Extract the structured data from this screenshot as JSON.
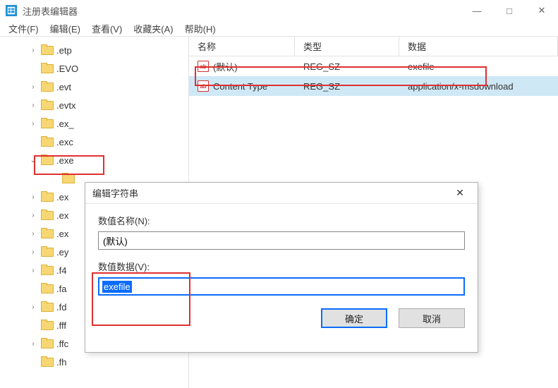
{
  "window": {
    "title": "注册表编辑器"
  },
  "menu": {
    "file": "文件(F)",
    "edit": "编辑(E)",
    "view": "查看(V)",
    "fav": "收藏夹(A)",
    "help": "帮助(H)"
  },
  "tree": {
    "items": [
      {
        "indent": 40,
        "toggle": ">",
        "label": ".etp"
      },
      {
        "indent": 40,
        "toggle": "",
        "label": ".EVO"
      },
      {
        "indent": 40,
        "toggle": ">",
        "label": ".evt"
      },
      {
        "indent": 40,
        "toggle": ">",
        "label": ".evtx"
      },
      {
        "indent": 40,
        "toggle": ">",
        "label": ".ex_"
      },
      {
        "indent": 40,
        "toggle": "",
        "label": ".exc"
      },
      {
        "indent": 40,
        "toggle": "v",
        "label": ".exe"
      },
      {
        "indent": 70,
        "toggle": "",
        "label": ""
      },
      {
        "indent": 40,
        "toggle": ">",
        "label": ".ex"
      },
      {
        "indent": 40,
        "toggle": ">",
        "label": ".ex"
      },
      {
        "indent": 40,
        "toggle": ">",
        "label": ".ex"
      },
      {
        "indent": 40,
        "toggle": ">",
        "label": ".ey"
      },
      {
        "indent": 40,
        "toggle": ">",
        "label": ".f4"
      },
      {
        "indent": 40,
        "toggle": "",
        "label": ".fa"
      },
      {
        "indent": 40,
        "toggle": ">",
        "label": ".fd"
      },
      {
        "indent": 40,
        "toggle": "",
        "label": ".fff"
      },
      {
        "indent": 40,
        "toggle": ">",
        "label": ".ffc"
      },
      {
        "indent": 40,
        "toggle": "",
        "label": ".fh"
      }
    ]
  },
  "list": {
    "headers": {
      "name": "名称",
      "type": "类型",
      "data": "数据"
    },
    "rows": [
      {
        "icon": "ab",
        "name": "(默认)",
        "type": "REG_SZ",
        "data": "exefile",
        "selected": false
      },
      {
        "icon": "ab",
        "name": "Content Type",
        "type": "REG_SZ",
        "data": "application/x-msdownload",
        "selected": true
      }
    ]
  },
  "dialog": {
    "title": "编辑字符串",
    "name_label": "数值名称(N):",
    "name_value": "(默认)",
    "data_label": "数值数据(V):",
    "data_value": "exefile",
    "ok": "确定",
    "cancel": "取消"
  }
}
